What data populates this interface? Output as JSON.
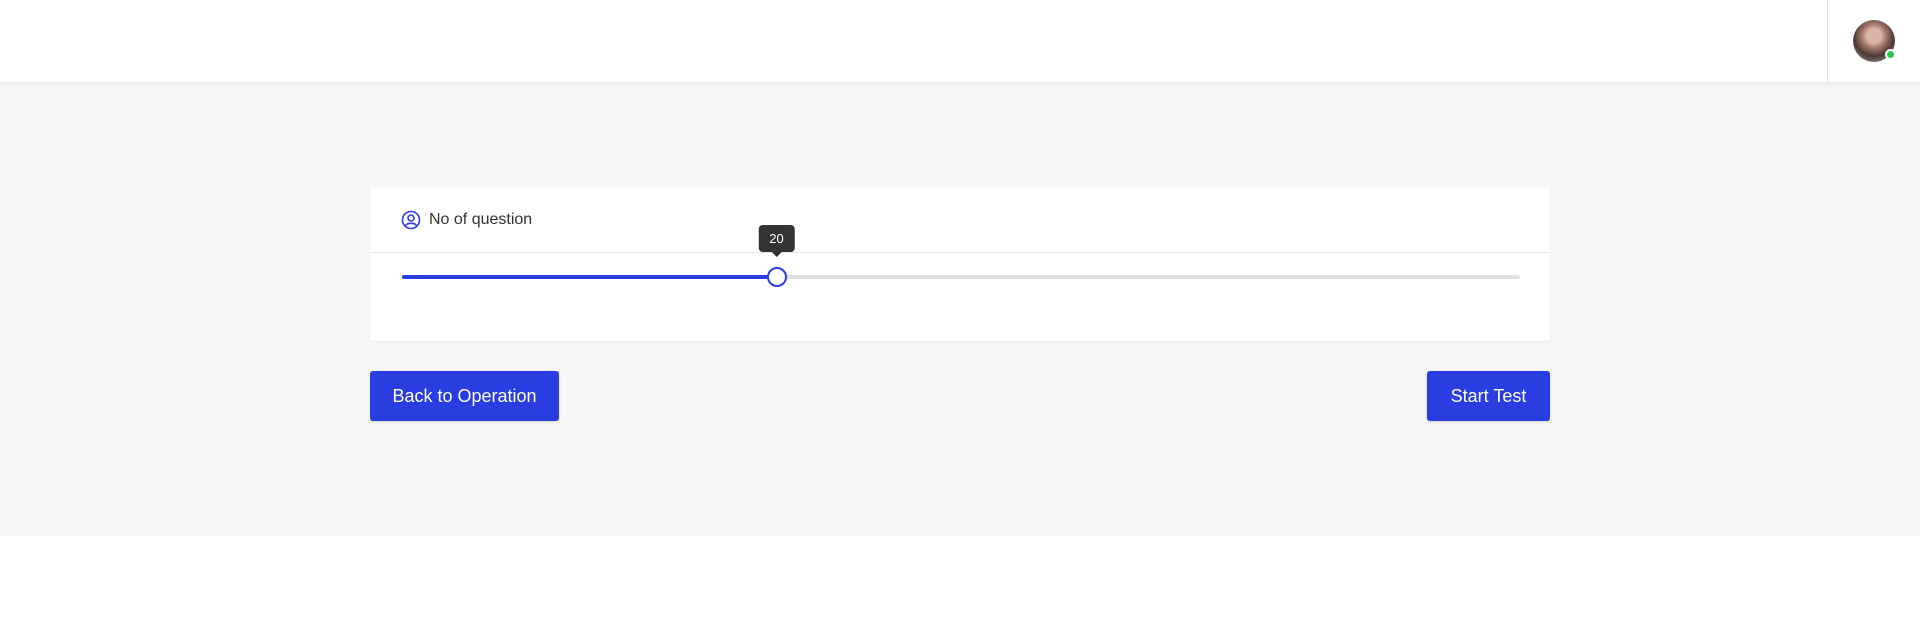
{
  "header": {
    "avatar_icon": "user-avatar",
    "status_color": "#2cc84a"
  },
  "question_card": {
    "label": "No of question",
    "icon": "user-circle-icon",
    "slider": {
      "value": "20",
      "fraction": 0.335,
      "accent": "#2a3de0"
    }
  },
  "actions": {
    "back_label": "Back to Operation",
    "start_label": "Start Test"
  }
}
